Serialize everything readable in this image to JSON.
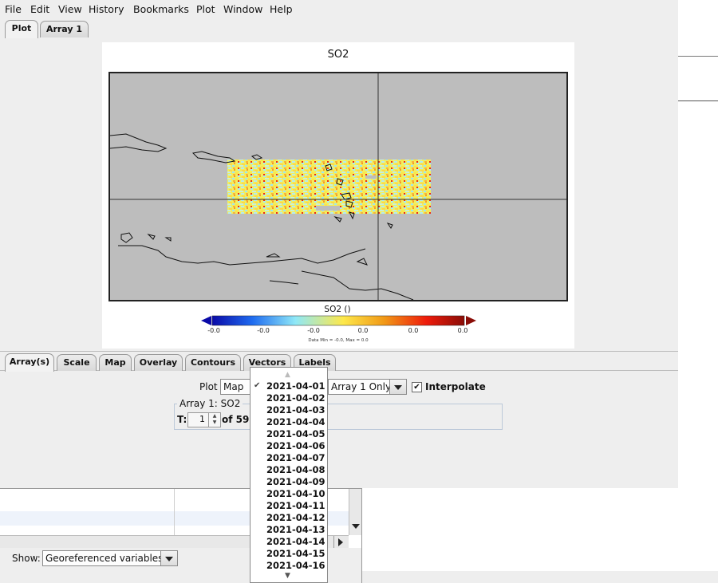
{
  "menubar": {
    "items": [
      "File",
      "Edit",
      "View",
      "History",
      "Bookmarks",
      "Plot",
      "Window",
      "Help"
    ]
  },
  "top_tabs": [
    "Plot",
    "Array 1"
  ],
  "plot": {
    "title": "SO2",
    "colorbar": {
      "title": "SO2 ()",
      "ticks": [
        "-0.0",
        "-0.0",
        "-0.0",
        "0.0",
        "0.0",
        "0.0"
      ],
      "minmax": "Data Min = -0.0, Max = 0.0",
      "colors": [
        "#0a0aa8",
        "#1f6cf0",
        "#8fe8f7",
        "#fde84a",
        "#f19a17",
        "#ee1b0b",
        "#8a0d07"
      ]
    }
  },
  "settings_tabs": [
    "Array(s)",
    "Scale",
    "Map",
    "Overlay",
    "Contours",
    "Vectors",
    "Labels"
  ],
  "controls": {
    "plot_label": "Plot",
    "plot_type": "Map",
    "array_mode": "Array 1 Only",
    "interpolate_label": "Interpolate",
    "interpolate_checked": true,
    "array_group_title": "Array 1: SO2",
    "t_label": "T:",
    "t_value": "1",
    "of_label": "of 59 ="
  },
  "dropdown": {
    "selected": "2021-04-01",
    "options": [
      "2021-04-01",
      "2021-04-02",
      "2021-04-03",
      "2021-04-04",
      "2021-04-05",
      "2021-04-06",
      "2021-04-07",
      "2021-04-08",
      "2021-04-09",
      "2021-04-10",
      "2021-04-11",
      "2021-04-12",
      "2021-04-13",
      "2021-04-14",
      "2021-04-15",
      "2021-04-16"
    ]
  },
  "show": {
    "label": "Show:",
    "value": "Georeferenced variables"
  }
}
